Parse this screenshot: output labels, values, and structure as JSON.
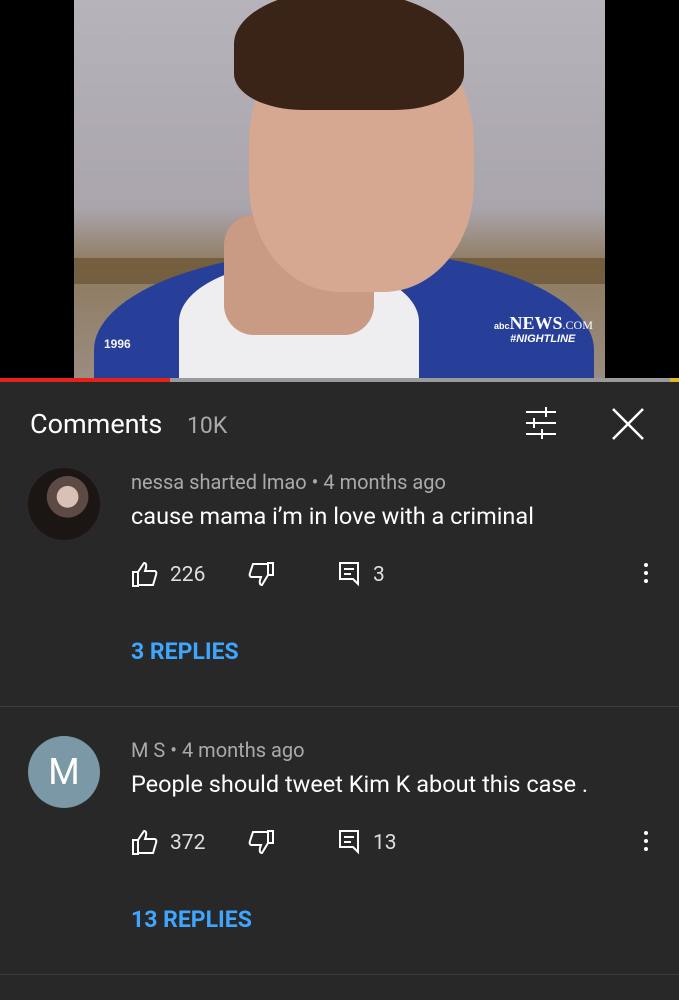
{
  "video": {
    "year_overlay": "1996",
    "network_logo": "NEWS",
    "network_logo_suffix": ".COM",
    "network_logo_prefix": "abc",
    "show_tag": "#NIGHTLINE",
    "progress_fraction": 0.25,
    "colors": {
      "played": "#e62117",
      "buffer": "#9a9a9a"
    }
  },
  "comments_panel": {
    "title": "Comments",
    "count": "10K",
    "filter_icon": "sliders-icon",
    "close_icon": "close-icon",
    "items": [
      {
        "author": "nessa sharted lmao",
        "time": "4 months ago",
        "text": "cause mama i’m in love with a criminal",
        "likes": "226",
        "reply_count": "3",
        "replies_label": "3 REPLIES",
        "avatar_type": "photo"
      },
      {
        "author": "M S",
        "time": "4 months ago",
        "text": "People should tweet Kim K about this case .",
        "likes": "372",
        "reply_count": "13",
        "replies_label": "13 REPLIES",
        "avatar_letter": "M",
        "avatar_color": "#7b98a6"
      }
    ],
    "separator": " • ",
    "accent_color": "#3ea6ff"
  }
}
